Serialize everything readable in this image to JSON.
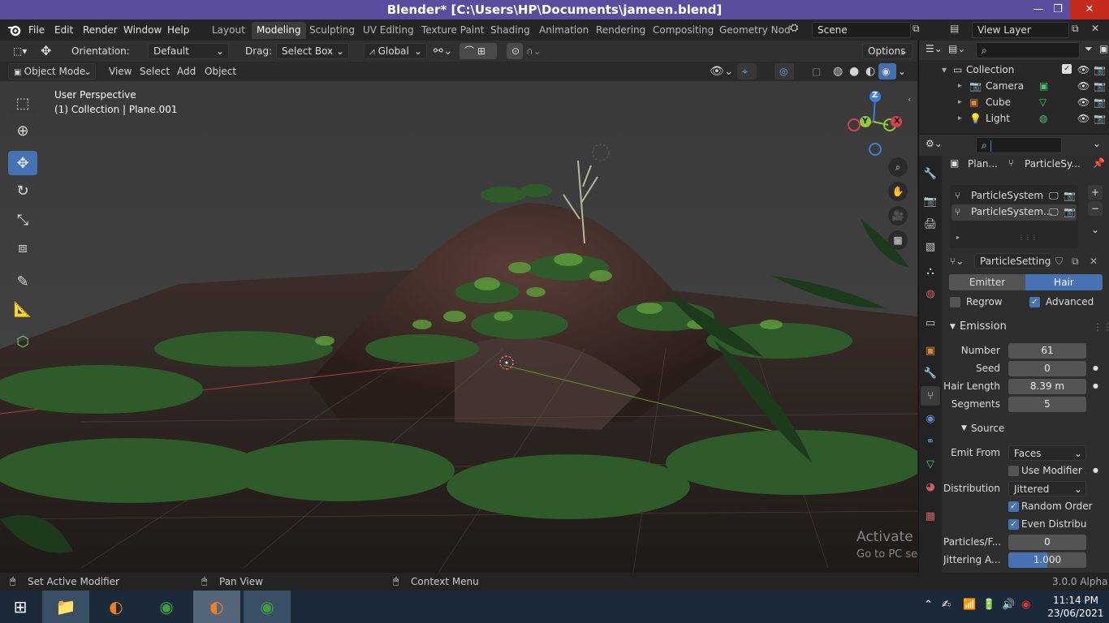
{
  "titlebar": {
    "title": "Blender* [C:\\Users\\HP\\Documents\\jameen.blend]",
    "minimize": "—",
    "restore": "❐",
    "close": "✕"
  },
  "menu": {
    "file": "File",
    "edit": "Edit",
    "render": "Render",
    "window": "Window",
    "help": "Help"
  },
  "workspaces": [
    "Layout",
    "Modeling",
    "Sculpting",
    "UV Editing",
    "Texture Paint",
    "Shading",
    "Animation",
    "Rendering",
    "Compositing",
    "Geometry Nod"
  ],
  "active_workspace": "Modeling",
  "scene": {
    "label": "Scene"
  },
  "view_layer": {
    "label": "View Layer"
  },
  "tool_header": {
    "orientation_label": "Orientation:",
    "orientation_value": "Default",
    "drag_label": "Drag:",
    "drag_value": "Select Box",
    "transform_value": "Global",
    "options": "Options"
  },
  "viewport_header": {
    "mode": "Object Mode",
    "view": "View",
    "select": "Select",
    "add": "Add",
    "object": "Object"
  },
  "viewport": {
    "perspective": "User Perspective",
    "collection_info": "(1) Collection | Plane.001"
  },
  "gizmo": {
    "z": "Z",
    "y": "Y",
    "x": "X"
  },
  "outliner": {
    "collection": "Collection",
    "items": [
      {
        "name": "Camera"
      },
      {
        "name": "Cube"
      },
      {
        "name": "Light"
      }
    ]
  },
  "properties": {
    "breadcrumb_object": "Plan...",
    "breadcrumb_system": "ParticleSy...",
    "particle_systems": [
      "ParticleSystem",
      "ParticleSystem..."
    ],
    "settings_name": "ParticleSettings...",
    "type_emitter": "Emitter",
    "type_hair": "Hair",
    "regrow": "Regrow",
    "advanced": "Advanced",
    "emission_title": "Emission",
    "number_label": "Number",
    "number_value": "61",
    "seed_label": "Seed",
    "seed_value": "0",
    "hair_length_label": "Hair Length",
    "hair_length_value": "8.39 m",
    "segments_label": "Segments",
    "segments_value": "5",
    "source_title": "Source",
    "emit_from_label": "Emit From",
    "emit_from_value": "Faces",
    "use_modifier": "Use Modifier ...",
    "distribution_label": "Distribution",
    "distribution_value": "Jittered",
    "random_order": "Random Order",
    "even_distribution": "Even Distribu...",
    "particles_face_label": "Particles/F...",
    "particles_face_value": "0",
    "jittering_label": "Jittering A...",
    "jittering_value": "1.000"
  },
  "watermark": {
    "line1": "Activate Windows",
    "line2": "Go to PC settings to activate Windows."
  },
  "statusbar": {
    "left": "Set Active Modifier",
    "middle": "Pan View",
    "right": "Context Menu",
    "version": "3.0.0 Alpha"
  },
  "taskbar": {
    "time": "11:14 PM",
    "date": "23/06/2021"
  },
  "colors": {
    "accent": "#4772b3",
    "title": "#5a4d9d"
  }
}
